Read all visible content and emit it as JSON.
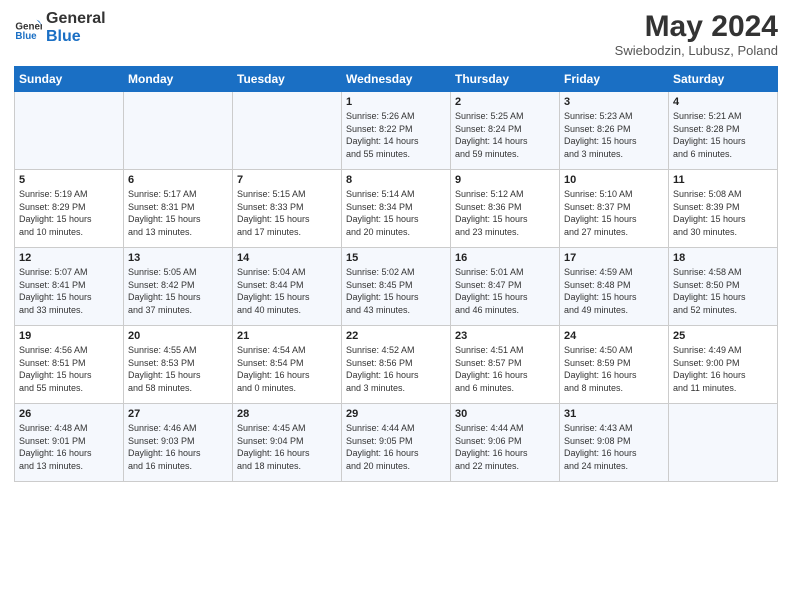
{
  "header": {
    "logo_line1": "General",
    "logo_line2": "Blue",
    "month_title": "May 2024",
    "subtitle": "Swiebodzin, Lubusz, Poland"
  },
  "days_of_week": [
    "Sunday",
    "Monday",
    "Tuesday",
    "Wednesday",
    "Thursday",
    "Friday",
    "Saturday"
  ],
  "weeks": [
    [
      {
        "day": "",
        "info": ""
      },
      {
        "day": "",
        "info": ""
      },
      {
        "day": "",
        "info": ""
      },
      {
        "day": "1",
        "info": "Sunrise: 5:26 AM\nSunset: 8:22 PM\nDaylight: 14 hours\nand 55 minutes."
      },
      {
        "day": "2",
        "info": "Sunrise: 5:25 AM\nSunset: 8:24 PM\nDaylight: 14 hours\nand 59 minutes."
      },
      {
        "day": "3",
        "info": "Sunrise: 5:23 AM\nSunset: 8:26 PM\nDaylight: 15 hours\nand 3 minutes."
      },
      {
        "day": "4",
        "info": "Sunrise: 5:21 AM\nSunset: 8:28 PM\nDaylight: 15 hours\nand 6 minutes."
      }
    ],
    [
      {
        "day": "5",
        "info": "Sunrise: 5:19 AM\nSunset: 8:29 PM\nDaylight: 15 hours\nand 10 minutes."
      },
      {
        "day": "6",
        "info": "Sunrise: 5:17 AM\nSunset: 8:31 PM\nDaylight: 15 hours\nand 13 minutes."
      },
      {
        "day": "7",
        "info": "Sunrise: 5:15 AM\nSunset: 8:33 PM\nDaylight: 15 hours\nand 17 minutes."
      },
      {
        "day": "8",
        "info": "Sunrise: 5:14 AM\nSunset: 8:34 PM\nDaylight: 15 hours\nand 20 minutes."
      },
      {
        "day": "9",
        "info": "Sunrise: 5:12 AM\nSunset: 8:36 PM\nDaylight: 15 hours\nand 23 minutes."
      },
      {
        "day": "10",
        "info": "Sunrise: 5:10 AM\nSunset: 8:37 PM\nDaylight: 15 hours\nand 27 minutes."
      },
      {
        "day": "11",
        "info": "Sunrise: 5:08 AM\nSunset: 8:39 PM\nDaylight: 15 hours\nand 30 minutes."
      }
    ],
    [
      {
        "day": "12",
        "info": "Sunrise: 5:07 AM\nSunset: 8:41 PM\nDaylight: 15 hours\nand 33 minutes."
      },
      {
        "day": "13",
        "info": "Sunrise: 5:05 AM\nSunset: 8:42 PM\nDaylight: 15 hours\nand 37 minutes."
      },
      {
        "day": "14",
        "info": "Sunrise: 5:04 AM\nSunset: 8:44 PM\nDaylight: 15 hours\nand 40 minutes."
      },
      {
        "day": "15",
        "info": "Sunrise: 5:02 AM\nSunset: 8:45 PM\nDaylight: 15 hours\nand 43 minutes."
      },
      {
        "day": "16",
        "info": "Sunrise: 5:01 AM\nSunset: 8:47 PM\nDaylight: 15 hours\nand 46 minutes."
      },
      {
        "day": "17",
        "info": "Sunrise: 4:59 AM\nSunset: 8:48 PM\nDaylight: 15 hours\nand 49 minutes."
      },
      {
        "day": "18",
        "info": "Sunrise: 4:58 AM\nSunset: 8:50 PM\nDaylight: 15 hours\nand 52 minutes."
      }
    ],
    [
      {
        "day": "19",
        "info": "Sunrise: 4:56 AM\nSunset: 8:51 PM\nDaylight: 15 hours\nand 55 minutes."
      },
      {
        "day": "20",
        "info": "Sunrise: 4:55 AM\nSunset: 8:53 PM\nDaylight: 15 hours\nand 58 minutes."
      },
      {
        "day": "21",
        "info": "Sunrise: 4:54 AM\nSunset: 8:54 PM\nDaylight: 16 hours\nand 0 minutes."
      },
      {
        "day": "22",
        "info": "Sunrise: 4:52 AM\nSunset: 8:56 PM\nDaylight: 16 hours\nand 3 minutes."
      },
      {
        "day": "23",
        "info": "Sunrise: 4:51 AM\nSunset: 8:57 PM\nDaylight: 16 hours\nand 6 minutes."
      },
      {
        "day": "24",
        "info": "Sunrise: 4:50 AM\nSunset: 8:59 PM\nDaylight: 16 hours\nand 8 minutes."
      },
      {
        "day": "25",
        "info": "Sunrise: 4:49 AM\nSunset: 9:00 PM\nDaylight: 16 hours\nand 11 minutes."
      }
    ],
    [
      {
        "day": "26",
        "info": "Sunrise: 4:48 AM\nSunset: 9:01 PM\nDaylight: 16 hours\nand 13 minutes."
      },
      {
        "day": "27",
        "info": "Sunrise: 4:46 AM\nSunset: 9:03 PM\nDaylight: 16 hours\nand 16 minutes."
      },
      {
        "day": "28",
        "info": "Sunrise: 4:45 AM\nSunset: 9:04 PM\nDaylight: 16 hours\nand 18 minutes."
      },
      {
        "day": "29",
        "info": "Sunrise: 4:44 AM\nSunset: 9:05 PM\nDaylight: 16 hours\nand 20 minutes."
      },
      {
        "day": "30",
        "info": "Sunrise: 4:44 AM\nSunset: 9:06 PM\nDaylight: 16 hours\nand 22 minutes."
      },
      {
        "day": "31",
        "info": "Sunrise: 4:43 AM\nSunset: 9:08 PM\nDaylight: 16 hours\nand 24 minutes."
      },
      {
        "day": "",
        "info": ""
      }
    ]
  ]
}
